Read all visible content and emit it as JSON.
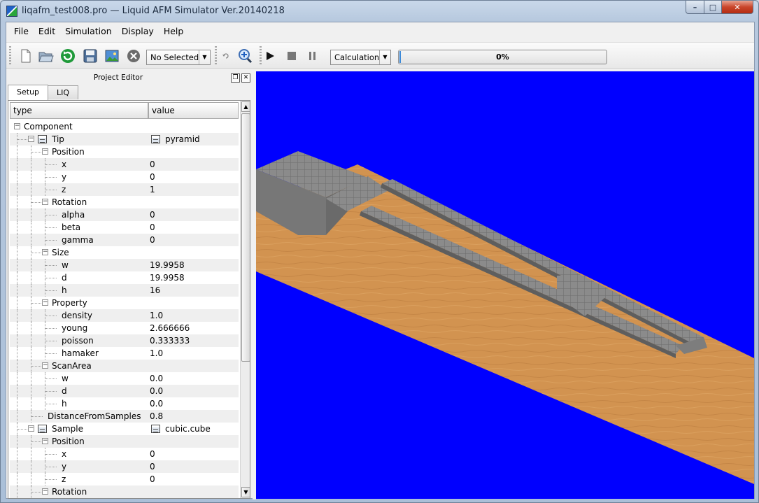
{
  "window": {
    "title": "liqafm_test008.pro — Liquid AFM Simulator Ver.20140218",
    "min_glyph": "–",
    "max_glyph": "□",
    "close_glyph": "✕"
  },
  "menu": [
    "File",
    "Edit",
    "Simulation",
    "Display",
    "Help"
  ],
  "toolbar": {
    "icons": [
      "new-file-icon",
      "open-folder-icon",
      "refresh-icon",
      "save-icon",
      "image-icon",
      "stop-circle-icon",
      "undo-icon",
      "zoom-in-icon",
      "play-icon",
      "stop-icon",
      "pause-icon"
    ],
    "selection_combo": "No Selected",
    "mode_combo": "Calculation",
    "progress_text": "0%",
    "progress_fraction": 0.0
  },
  "editor": {
    "dock_title": "Project Editor",
    "tabs": [
      "Setup",
      "LIQ"
    ],
    "active_tab": "Setup",
    "columns": [
      "type",
      "value"
    ],
    "rows": [
      {
        "label": "Component",
        "value": "",
        "depth": 0,
        "expander": "minus"
      },
      {
        "label": "Tip",
        "value": "pyramid",
        "depth": 1,
        "expander": "minus",
        "icon": true,
        "value_icon": true
      },
      {
        "label": "Position",
        "value": "",
        "depth": 2,
        "expander": "minus"
      },
      {
        "label": "x",
        "value": "0",
        "depth": 3
      },
      {
        "label": "y",
        "value": "0",
        "depth": 3
      },
      {
        "label": "z",
        "value": "1",
        "depth": 3
      },
      {
        "label": "Rotation",
        "value": "",
        "depth": 2,
        "expander": "minus"
      },
      {
        "label": "alpha",
        "value": "0",
        "depth": 3
      },
      {
        "label": "beta",
        "value": "0",
        "depth": 3
      },
      {
        "label": "gamma",
        "value": "0",
        "depth": 3
      },
      {
        "label": "Size",
        "value": "",
        "depth": 2,
        "expander": "minus"
      },
      {
        "label": "w",
        "value": "19.9958",
        "depth": 3
      },
      {
        "label": "d",
        "value": "19.9958",
        "depth": 3
      },
      {
        "label": "h",
        "value": "16",
        "depth": 3
      },
      {
        "label": "Property",
        "value": "",
        "depth": 2,
        "expander": "minus"
      },
      {
        "label": "density",
        "value": "1.0",
        "depth": 3
      },
      {
        "label": "young",
        "value": "2.666666",
        "depth": 3
      },
      {
        "label": "poisson",
        "value": "0.333333",
        "depth": 3
      },
      {
        "label": "hamaker",
        "value": "1.0",
        "depth": 3
      },
      {
        "label": "ScanArea",
        "value": "",
        "depth": 2,
        "expander": "minus"
      },
      {
        "label": "w",
        "value": "0.0",
        "depth": 3
      },
      {
        "label": "d",
        "value": "0.0",
        "depth": 3
      },
      {
        "label": "h",
        "value": "0.0",
        "depth": 3
      },
      {
        "label": "DistanceFromSamples",
        "value": "0.8",
        "depth": 2
      },
      {
        "label": "Sample",
        "value": "cubic.cube",
        "depth": 1,
        "expander": "minus",
        "icon": true,
        "value_icon": true
      },
      {
        "label": "Position",
        "value": "",
        "depth": 2,
        "expander": "minus"
      },
      {
        "label": "x",
        "value": "0",
        "depth": 3
      },
      {
        "label": "y",
        "value": "0",
        "depth": 3
      },
      {
        "label": "z",
        "value": "0",
        "depth": 3
      },
      {
        "label": "Rotation",
        "value": "",
        "depth": 2,
        "expander": "minus"
      }
    ]
  },
  "viewport": {
    "background": "#0000ff",
    "sample_color": "#d2944e",
    "tip_color": "#8a8a8a"
  }
}
